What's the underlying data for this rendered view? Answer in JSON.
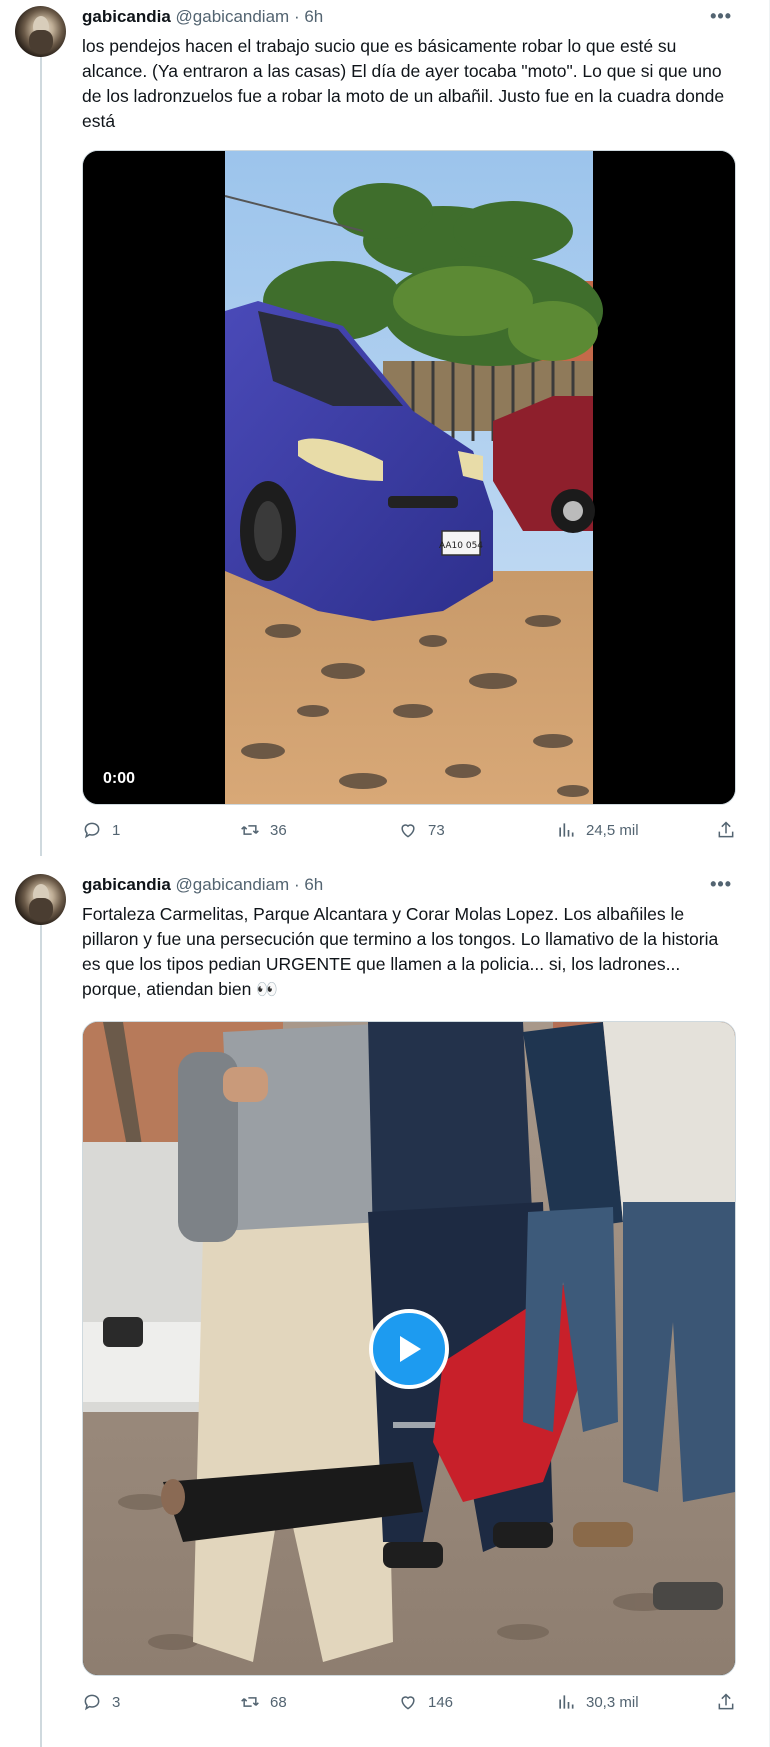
{
  "tweets": [
    {
      "display_name": "gabicandia",
      "handle": "@gabicandiam",
      "time": "6h",
      "more_icon": "more-horizontal-icon",
      "text": "los pendejos hacen el trabajo sucio que es básicamente robar lo que esté su alcance. (Ya entraron a las casas) El día de ayer tocaba \"moto\". Lo que si que uno de los ladronzuelos fue a robar la moto de un albañil. Justo fue en la cuadra donde está",
      "media": {
        "type": "video",
        "duration": "0:00",
        "plate": "AA10 054"
      },
      "stats": {
        "replies": "1",
        "reposts": "36",
        "likes": "73",
        "views": "24,5 mil"
      }
    },
    {
      "display_name": "gabicandia",
      "handle": "@gabicandiam",
      "time": "6h",
      "more_icon": "more-horizontal-icon",
      "text": "Fortaleza Carmelitas, Parque Alcantara y Corar Molas Lopez. Los albañiles le pillaron y fue una persecución que termino a los tongos. Lo llamativo de la historia es que los tipos pedian URGENTE que llamen a la policia... si, los ladrones... porque, atiendan bien 👀",
      "media": {
        "type": "video",
        "play_icon": "play-icon"
      },
      "stats": {
        "replies": "3",
        "reposts": "68",
        "likes": "146",
        "views": "30,3 mil"
      }
    }
  ],
  "colors": {
    "accent": "#1d9bf0",
    "secondary_text": "#536471",
    "border": "#cfd9de"
  }
}
